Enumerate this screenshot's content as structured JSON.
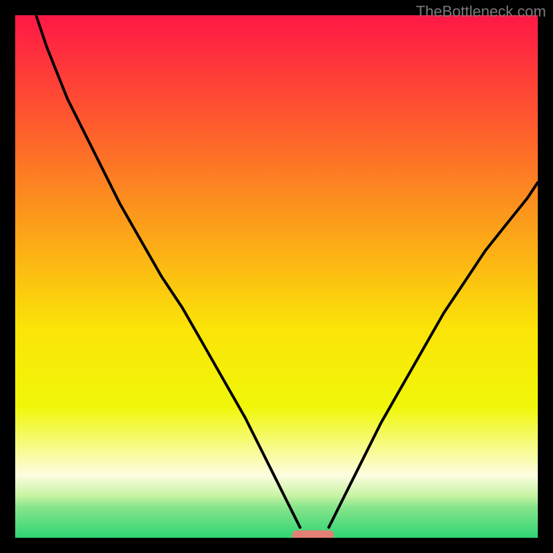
{
  "attribution": "TheBottleneck.com",
  "chart_data": {
    "type": "line",
    "title": "",
    "xlabel": "",
    "ylabel": "",
    "xlim": [
      0,
      100
    ],
    "ylim": [
      0,
      100
    ],
    "legend": false,
    "grid": false,
    "background_gradient_vertical": [
      {
        "pos": 0,
        "color": "#ff1846"
      },
      {
        "pos": 20,
        "color": "#fe582e"
      },
      {
        "pos": 40,
        "color": "#fc9e1a"
      },
      {
        "pos": 60,
        "color": "#fbe408"
      },
      {
        "pos": 75,
        "color": "#f0f709"
      },
      {
        "pos": 88,
        "color": "#fdfde1"
      },
      {
        "pos": 92,
        "color": "#c6f3a2"
      },
      {
        "pos": 94,
        "color": "#89e58c"
      },
      {
        "pos": 100,
        "color": "#2fd574"
      }
    ],
    "series": [
      {
        "name": "left-curve",
        "color": "#000000",
        "x": [
          4,
          6,
          8,
          10,
          13,
          16,
          20,
          24,
          28,
          32,
          36,
          40,
          44,
          48,
          50,
          52,
          53.5,
          54.5
        ],
        "y": [
          100,
          94,
          89,
          84,
          78,
          72,
          64,
          57,
          50,
          44,
          37,
          30,
          23,
          15,
          11,
          7,
          4,
          2
        ]
      },
      {
        "name": "right-curve",
        "color": "#000000",
        "x": [
          60,
          61,
          63,
          66,
          70,
          74,
          78,
          82,
          86,
          90,
          94,
          98,
          100
        ],
        "y": [
          2,
          4,
          8,
          14,
          22,
          29,
          36,
          43,
          49,
          55,
          60,
          65,
          68
        ]
      }
    ],
    "marker": {
      "name": "bottleneck-marker",
      "color": "#e28078",
      "x_start": 53,
      "x_end": 61,
      "y": 0.5
    },
    "frame": {
      "color": "#000000",
      "thickness_px": 22
    }
  }
}
